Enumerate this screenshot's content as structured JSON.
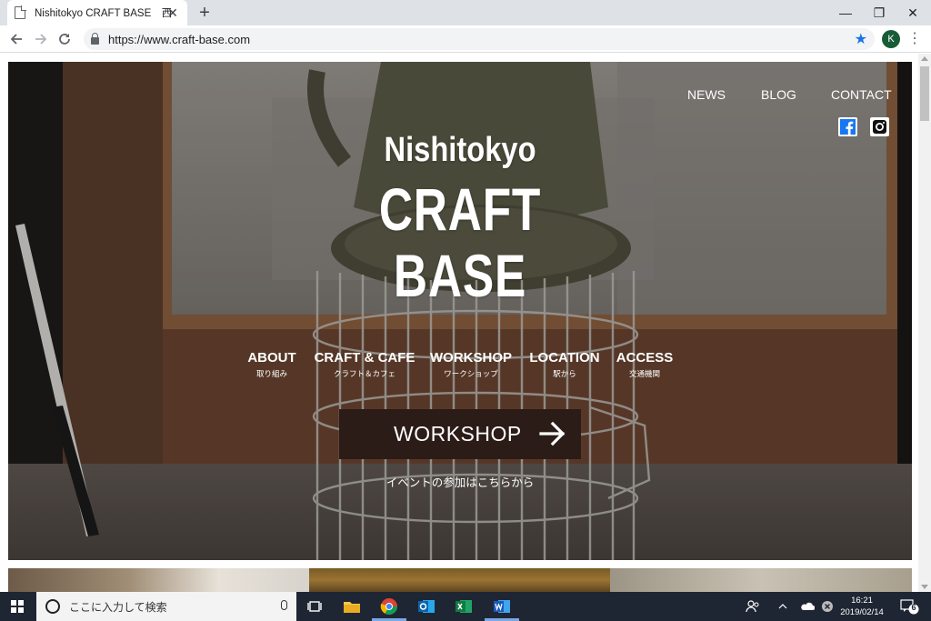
{
  "browser": {
    "tab_title": "Nishitokyo CRAFT BASE　西東京",
    "url": "https://www.craft-base.com",
    "profile_initial": "K",
    "window_controls": {
      "minimize": "—",
      "restore": "❐",
      "close": "✕"
    },
    "tab_close": "✕",
    "new_tab": "+"
  },
  "site": {
    "top_nav": [
      {
        "label": "NEWS"
      },
      {
        "label": "BLOG"
      },
      {
        "label": "CONTACT"
      }
    ],
    "social": [
      "facebook-icon",
      "instagram-icon"
    ],
    "logo": {
      "line1": "Nishitokyo",
      "line2": "CRAFT",
      "line3": "BASE"
    },
    "main_nav": [
      {
        "en": "ABOUT",
        "jp": "取り組み"
      },
      {
        "en": "CRAFT & CAFE",
        "jp": "クラフト＆カフェ"
      },
      {
        "en": "WORKSHOP",
        "jp": "ワークショップ"
      },
      {
        "en": "LOCATION",
        "jp": "駅から"
      },
      {
        "en": "ACCESS",
        "jp": "交通機関"
      }
    ],
    "cta": {
      "label": "WORKSHOP",
      "sub": "イベントの参加はこちらから"
    }
  },
  "taskbar": {
    "search_placeholder": "ここに入力して検索",
    "apps": [
      "task-view-icon",
      "file-explorer-icon",
      "chrome-icon",
      "outlook-icon",
      "excel-icon",
      "word-icon"
    ],
    "time": "16:21",
    "date": "2019/02/14",
    "notification_count": "6"
  },
  "colors": {
    "cta_bg": "#2c1c17",
    "taskbar_bg": "#1f2633",
    "tabbar_bg": "#dee1e6"
  }
}
